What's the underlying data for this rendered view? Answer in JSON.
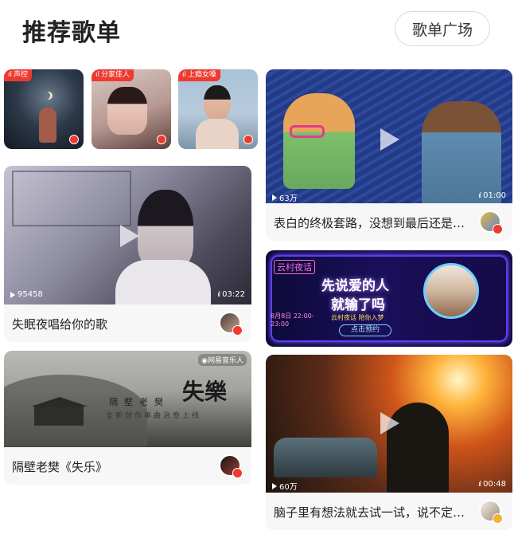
{
  "header": {
    "title": "推荐歌单",
    "plaza_button": "歌单广场"
  },
  "mini_cards": [
    {
      "tag": "声控"
    },
    {
      "tag": "分家佳人"
    },
    {
      "tag": "上瘾女嗓"
    }
  ],
  "left_cards": [
    {
      "caption": "失眠夜唱给你的歌",
      "plays": "95458",
      "duration": "03:22"
    },
    {
      "caption": "隔壁老樊《失乐》",
      "watermark": "网易音乐人",
      "overlay_big": "失樂",
      "overlay_small": "隔壁老樊",
      "overlay_line": "全新创作单曲治愈上线"
    }
  ],
  "right_cards": [
    {
      "caption": "表白的终极套路，没想到最后还是凉...",
      "plays": "63万",
      "duration": "01:00"
    },
    {
      "banner_badge": "云村夜话",
      "banner_title_1": "先说爱的人",
      "banner_title_2": "就输了吗",
      "banner_sub": "云村夜话 陪你入梦",
      "banner_btn": "点击预约",
      "banner_date": "8月8日 22:00-23:00"
    },
    {
      "caption": "脑子里有想法就去试一试，说不定就...",
      "plays": "60万",
      "duration": "00:48"
    }
  ],
  "colors": {
    "accent": "#ee3a30",
    "caption_bg": "#f7f7f7"
  }
}
